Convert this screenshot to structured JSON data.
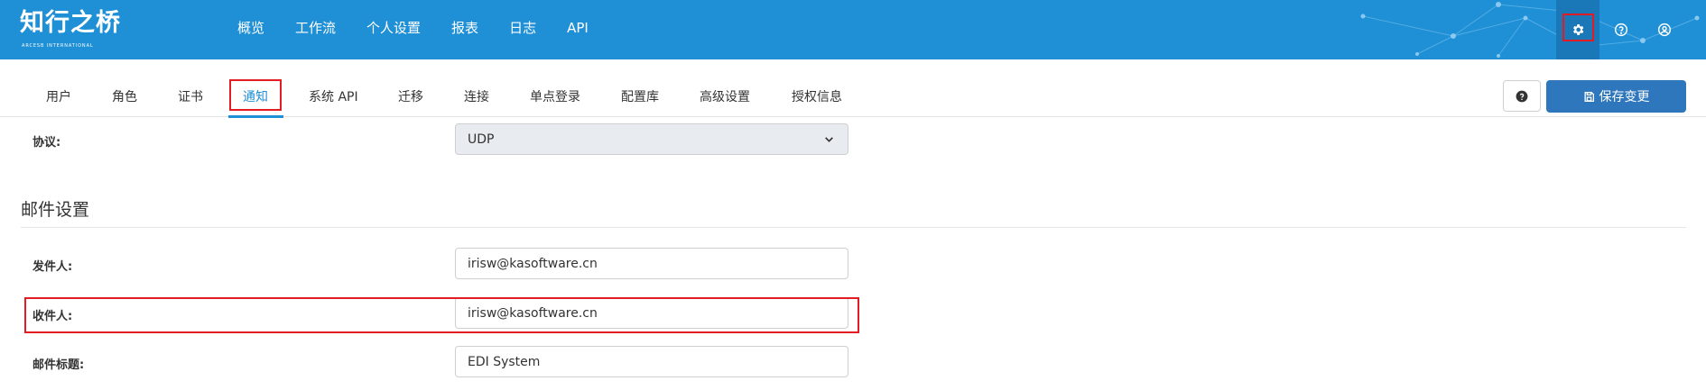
{
  "header": {
    "logo_text": "知行之桥",
    "logo_subtext": "ARCESB INTERNATIONAL",
    "nav": [
      "概览",
      "工作流",
      "个人设置",
      "报表",
      "日志",
      "API"
    ],
    "icons": [
      "gear-icon",
      "help-circle-icon",
      "user-circle-icon"
    ],
    "brand_color": "#1f8fd6"
  },
  "tabs": {
    "items": [
      "用户",
      "角色",
      "证书",
      "通知",
      "系统 API",
      "迁移",
      "连接",
      "单点登录",
      "配置库",
      "高级设置",
      "授权信息"
    ],
    "active": "通知"
  },
  "toolbar": {
    "help_icon": "question-circle-icon",
    "save_icon": "save-icon",
    "save_label": "保存变更"
  },
  "form": {
    "protocol_label": "协议:",
    "protocol_value": "UDP",
    "email_section_title": "邮件设置",
    "sender_label": "发件人:",
    "sender_value": "irisw@kasoftware.cn",
    "recipient_label": "收件人:",
    "recipient_value": "irisw@kasoftware.cn",
    "subject_label": "邮件标题:",
    "subject_value": "EDI System"
  },
  "annotation_color": "#e31b23"
}
